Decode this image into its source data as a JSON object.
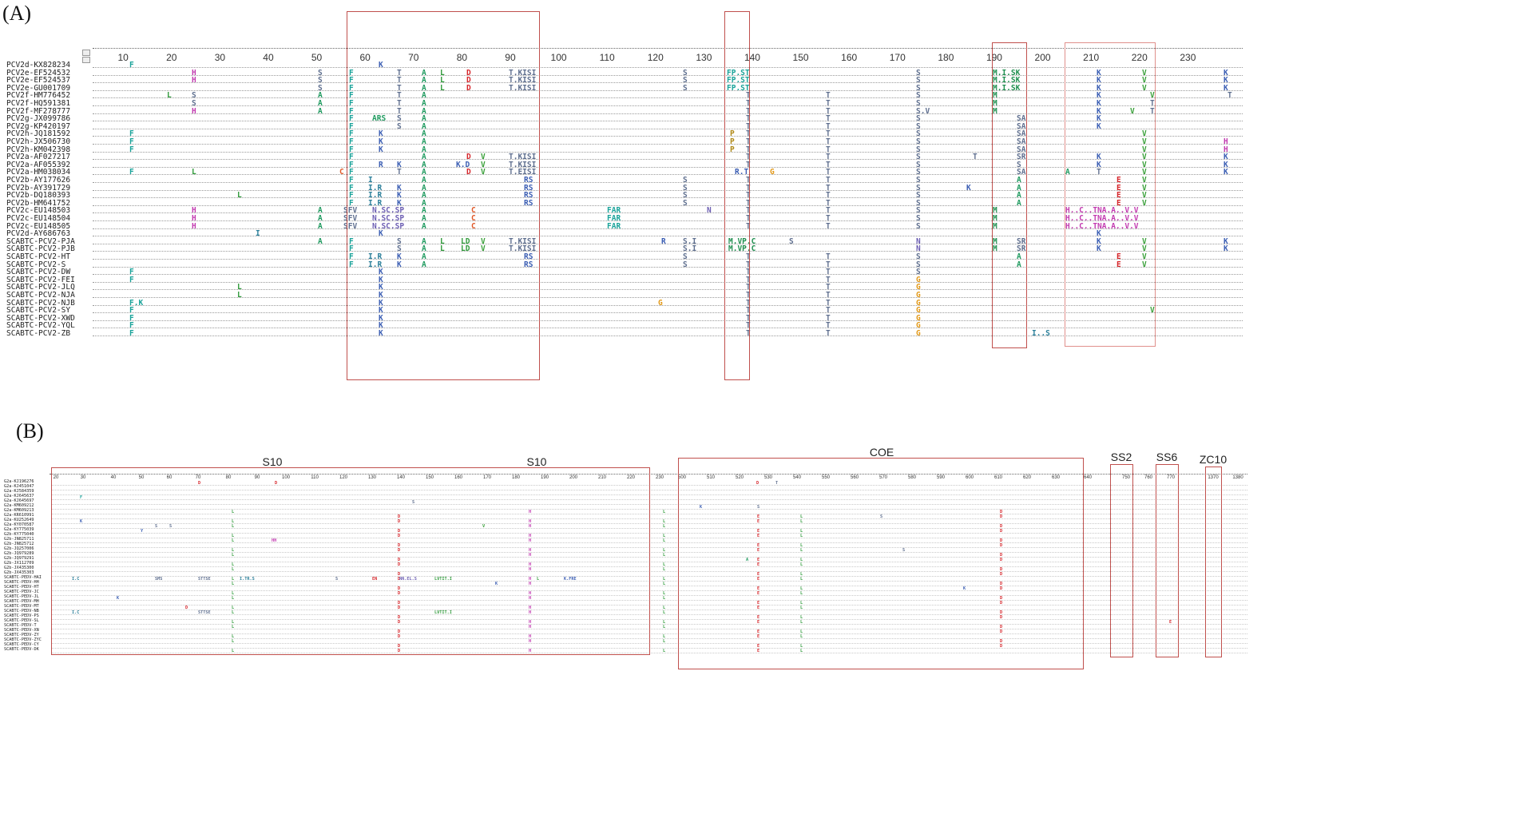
{
  "panel_a": {
    "label": "(A)",
    "ticks": [
      "10",
      "20",
      "30",
      "40",
      "50",
      "60",
      "70",
      "80",
      "90",
      "100",
      "110",
      "120",
      "130",
      "140",
      "150",
      "160",
      "170",
      "180",
      "190",
      "200",
      "210",
      "220",
      "230"
    ],
    "sequences": [
      "PCV2d-KX828234",
      "PCV2e-EF524532",
      "PCV2e-EF524537",
      "PCV2e-GU001709",
      "PCV2f-HM776452",
      "PCV2f-HQ591381",
      "PCV2f-MF278777",
      "PCV2g-JX099786",
      "PCV2g-KP420197",
      "PCV2h-JQ181592",
      "PCV2h-JX506730",
      "PCV2h-KM042398",
      "PCV2a-AF027217",
      "PCV2a-AF055392",
      "PCV2a-HM038034",
      "PCV2b-AY177626",
      "PCV2b-AY391729",
      "PCV2b-DQ180393",
      "PCV2b-HM641752",
      "PCV2c-EU148503",
      "PCV2c-EU148504",
      "PCV2c-EU148505",
      "PCV2d-AY686763",
      "SCABTC-PCV2-PJA",
      "SCABTC-PCV2-PJB",
      "SCABTC-PCV2-HT",
      "SCABTC-PCV2-S",
      "SCABTC-PCV2-DW",
      "SCABTC-PCV2-FEI",
      "SCABTC-PCV2-JLQ",
      "SCABTC-PCV2-NJA",
      "SCABTC-PCV2-NJB",
      "SCABTC-PCV2-SY",
      "SCABTC-PCV2-XWD",
      "SCABTC-PCV2-YQL",
      "SCABTC-PCV2-ZB"
    ]
  },
  "panel_b": {
    "label": "(B)",
    "ticks": [
      "20",
      "30",
      "40",
      "50",
      "60",
      "70",
      "80",
      "90",
      "100",
      "110",
      "120",
      "130",
      "140",
      "150",
      "160",
      "170",
      "180",
      "190",
      "200",
      "210",
      "220",
      "230",
      "500",
      "510",
      "520",
      "530",
      "540",
      "550",
      "560",
      "570",
      "580",
      "590",
      "600",
      "610",
      "620",
      "630",
      "640",
      "750",
      "760",
      "770",
      "1370",
      "1380"
    ],
    "region_labels": [
      "S10",
      "S10",
      "COE",
      "SS2",
      "SS6",
      "ZC10"
    ],
    "sequences": [
      "G2a-KJ196276",
      "G2a-KJ451047",
      "G2a-KJ584359",
      "G2a-KJ645637",
      "G2a-KJ645697",
      "G2a-KM609212",
      "G2a-KM609213",
      "G2a-KR610991",
      "G2a-KU252649",
      "G2a-KY070587",
      "G2a-KY775039",
      "G2b-KY775040",
      "G2b-JN825711",
      "G2b-JN825712",
      "G2b-JQ257006",
      "G2b-JQ979289",
      "G2b-JQ979291",
      "G2b-JX112709",
      "G2b-JX435300",
      "G2b-JX435303",
      "SCABTC-PEDV-HAI",
      "SCABTC-PEDV-HH",
      "SCABTC-PEDV-HT",
      "SCABTC-PEDV-JC",
      "SCABTC-PEDV-JL",
      "SCABTC-PEDV-MH",
      "SCABTC-PEDV-MT",
      "SCABTC-PEDV-NB",
      "SCABTC-PEDV-PS",
      "SCABTC-PEDV-SL",
      "SCABTC-PEDV-T",
      "SCABTC-PEDV-XN",
      "SCABTC-PEDV-ZY",
      "SCABTC-PEDV-ZYC",
      "SCABTC-PEDV-CY",
      "SCABTC-PEDV-DK"
    ]
  },
  "colors": {
    "box": "#c0504d",
    "residues": {
      "F": "#1aa39a",
      "K": "#3b5eb3",
      "H": "#c23bb0",
      "S": "#5f6f8f",
      "A": "#1f9a5f",
      "T": "#5f6f8f",
      "D": "#d6262b",
      "R": "#3b5eb3",
      "I": "#2b7f9a",
      "M": "#1f8f4f",
      "V": "#3aa03a",
      "E": "#d6262b",
      "G": "#e39a1a",
      "N": "#6d5fb3",
      "L": "#2f9a3a",
      "C": "#e05a2a",
      "P": "#b08a1a",
      "Q": "#1aa39a"
    }
  }
}
